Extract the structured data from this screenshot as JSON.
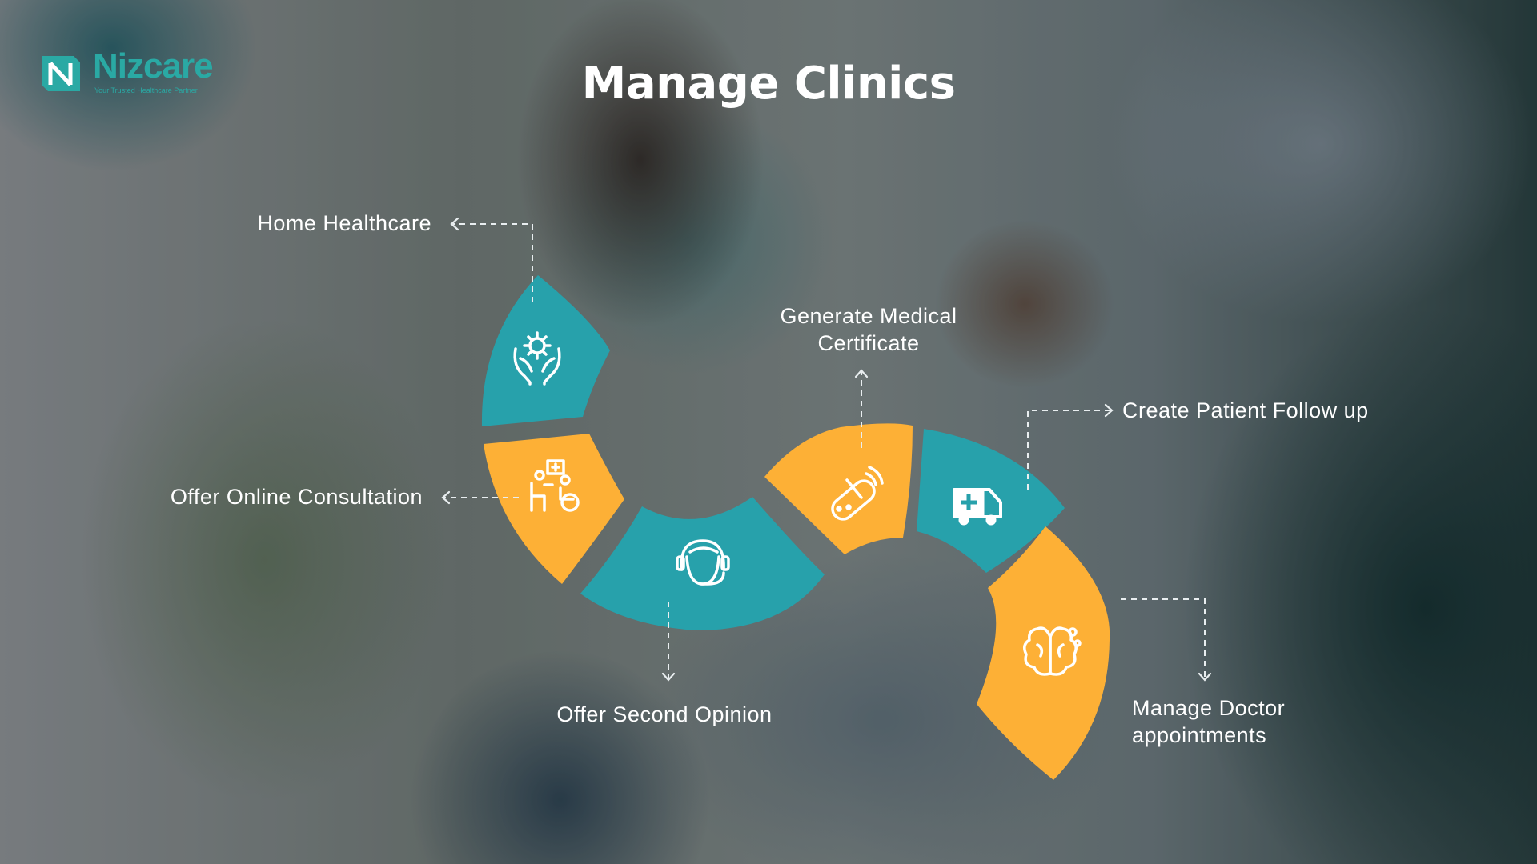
{
  "brand": {
    "name": "Nizcare",
    "tagline": "Your Trusted Healthcare Partner",
    "color": "#2aa9a4"
  },
  "title": "Manage Clinics",
  "colors": {
    "teal": "#27a1ab",
    "orange": "#fdb036",
    "text": "#ffffff"
  },
  "steps": [
    {
      "label": "Home Healthcare",
      "icon": "hands-gear-icon",
      "color": "teal"
    },
    {
      "label": "Offer Online Consultation",
      "icon": "doctor-patient-icon",
      "color": "orange"
    },
    {
      "label": "Offer Second Opinion",
      "icon": "headset-person-icon",
      "color": "teal"
    },
    {
      "label_line1": "Generate Medical",
      "label_line2": "Certificate",
      "icon": "pill-capsule-icon",
      "color": "orange"
    },
    {
      "label": "Create Patient Follow up",
      "icon": "ambulance-icon",
      "color": "teal"
    },
    {
      "label_line1": "Manage Doctor",
      "label_line2": "appointments",
      "icon": "brain-icon",
      "color": "orange"
    }
  ]
}
